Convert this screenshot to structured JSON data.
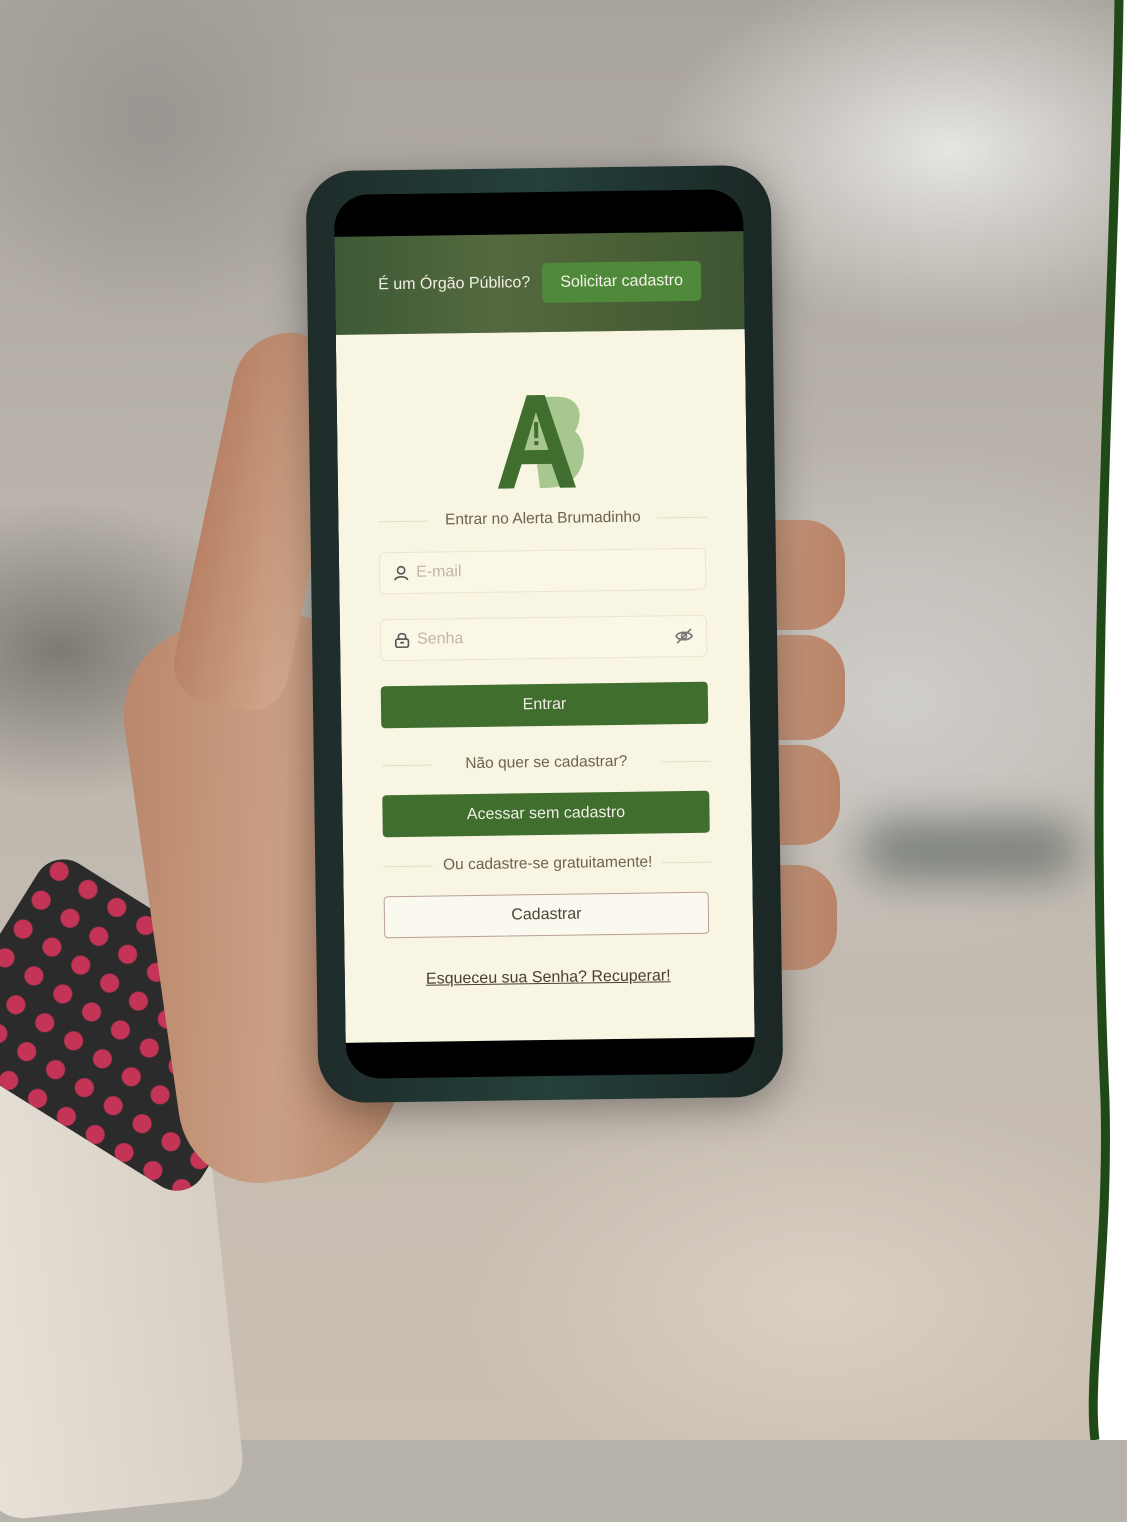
{
  "hero": {
    "question": "É um Órgão Público?",
    "request_button": "Solicitar cadastro"
  },
  "login": {
    "heading": "Entrar no Alerta Brumadinho",
    "email_placeholder": "E-mail",
    "password_placeholder": "Senha",
    "submit_button": "Entrar",
    "no_register_text": "Não quer se cadastrar?",
    "guest_button": "Acessar sem cadastro",
    "register_prompt": "Ou cadastre-se gratuitamente!",
    "register_button": "Cadastrar",
    "forgot_link": "Esqueceu sua Senha? Recuperar!"
  },
  "icons": {
    "email": "user-icon",
    "password": "lock-icon",
    "toggle_visibility": "eye-off-icon",
    "logo": "alerta-brumadinho-logo"
  },
  "colors": {
    "primary_green": "#3f6e2e",
    "hero_button_green": "#4f8a3b",
    "light_green": "#a8c78e",
    "screen_background": "#f8f5e3",
    "border_green": "#1f4a17"
  }
}
